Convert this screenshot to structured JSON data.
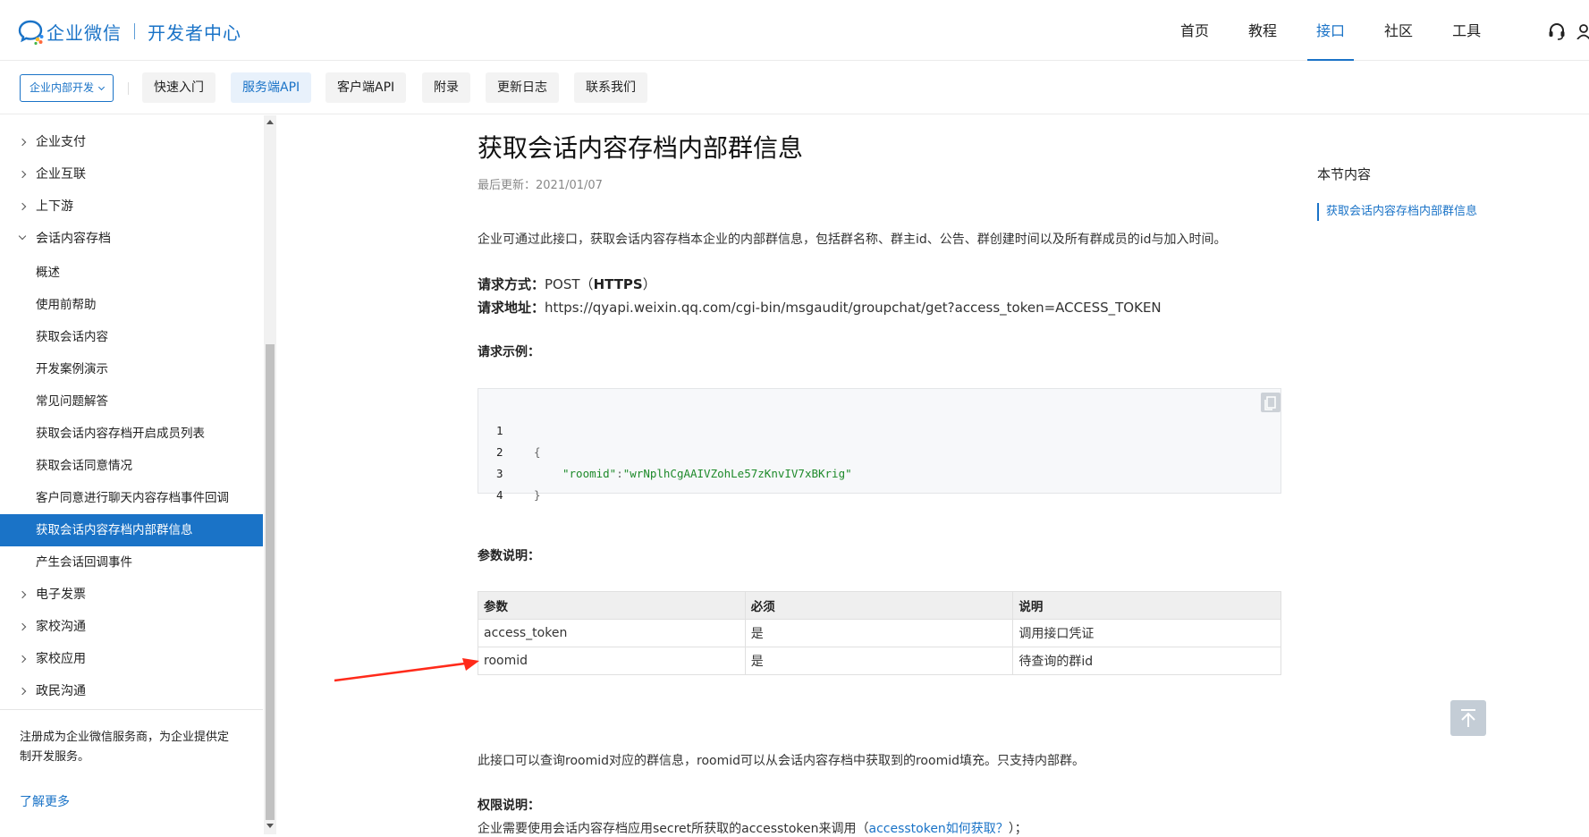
{
  "header": {
    "logo_text": "企业微信",
    "logo_sub": "开发者中心",
    "nav": [
      {
        "label": "首页",
        "active": false
      },
      {
        "label": "教程",
        "active": false
      },
      {
        "label": "接口",
        "active": true
      },
      {
        "label": "社区",
        "active": false
      },
      {
        "label": "工具",
        "active": false
      }
    ],
    "support_icon": "headset-icon",
    "accent_color": "#1a73c7"
  },
  "subnav": {
    "scope_select": "企业内部开发",
    "tabs": [
      {
        "label": "快速入门",
        "active": false
      },
      {
        "label": "服务端API",
        "active": true
      },
      {
        "label": "客户端API",
        "active": false
      },
      {
        "label": "附录",
        "active": false
      },
      {
        "label": "更新日志",
        "active": false
      },
      {
        "label": "联系我们",
        "active": false
      }
    ]
  },
  "sidebar": {
    "items": [
      {
        "label": "企业支付",
        "type": "group",
        "open": false
      },
      {
        "label": "企业互联",
        "type": "group",
        "open": false
      },
      {
        "label": "上下游",
        "type": "group",
        "open": false
      },
      {
        "label": "会话内容存档",
        "type": "group",
        "open": true
      },
      {
        "label": "概述",
        "type": "child",
        "active": false
      },
      {
        "label": "使用前帮助",
        "type": "child",
        "active": false
      },
      {
        "label": "获取会话内容",
        "type": "child",
        "active": false
      },
      {
        "label": "开发案例演示",
        "type": "child",
        "active": false
      },
      {
        "label": "常见问题解答",
        "type": "child",
        "active": false
      },
      {
        "label": "获取会话内容存档开启成员列表",
        "type": "child",
        "active": false
      },
      {
        "label": "获取会话同意情况",
        "type": "child",
        "active": false
      },
      {
        "label": "客户同意进行聊天内容存档事件回调",
        "type": "child",
        "active": false
      },
      {
        "label": "获取会话内容存档内部群信息",
        "type": "child",
        "active": true
      },
      {
        "label": "产生会话回调事件",
        "type": "child",
        "active": false
      },
      {
        "label": "电子发票",
        "type": "group",
        "open": false
      },
      {
        "label": "家校沟通",
        "type": "group",
        "open": false
      },
      {
        "label": "家校应用",
        "type": "group",
        "open": false
      },
      {
        "label": "政民沟通",
        "type": "group",
        "open": false
      }
    ],
    "footer_note": "注册成为企业微信服务商，为企业提供定制开发服务。",
    "footer_link": "了解更多"
  },
  "article": {
    "title": "获取会话内容存档内部群信息",
    "updated": "最后更新：2021/01/07",
    "intro": "企业可通过此接口，获取会话内容存档本企业的内部群信息，包括群名称、群主id、公告、群创建时间以及所有群成员的id与加入时间。",
    "method_label": "请求方式：",
    "method_value": "POST（",
    "method_bold": "HTTPS",
    "method_end": "）",
    "url_label": "请求地址：",
    "url_value": "https://qyapi.weixin.qq.com/cgi-bin/msgaudit/groupchat/get?access_token=ACCESS_TOKEN",
    "example_label": "请求示例：",
    "code": {
      "line_numbers": [
        "1",
        "2",
        "3",
        "4"
      ],
      "open_brace": "{",
      "key": "\"roomid\"",
      "colon": ":",
      "value": "\"wrNplhCgAAIVZohLe57zKnvIV7xBKrig\"",
      "close_brace": "}"
    },
    "params_label": "参数说明：",
    "params_table": {
      "headers": [
        "参数",
        "必须",
        "说明"
      ],
      "rows": [
        [
          "access_token",
          "是",
          "调用接口凭证"
        ],
        [
          "roomid",
          "是",
          "待查询的群id"
        ]
      ]
    },
    "note": "此接口可以查询roomid对应的群信息，roomid可以从会话内容存档中获取到的roomid填充。只支持内部群。",
    "perm_title": "权限说明：",
    "perm_text_pre": "企业需要使用会话内容存档应用secret所获取的accesstoken来调用（",
    "perm_link": "accesstoken如何获取？",
    "perm_text_post": "）；"
  },
  "toc": {
    "title": "本节内容",
    "items": [
      "获取会话内容存档内部群信息"
    ]
  }
}
